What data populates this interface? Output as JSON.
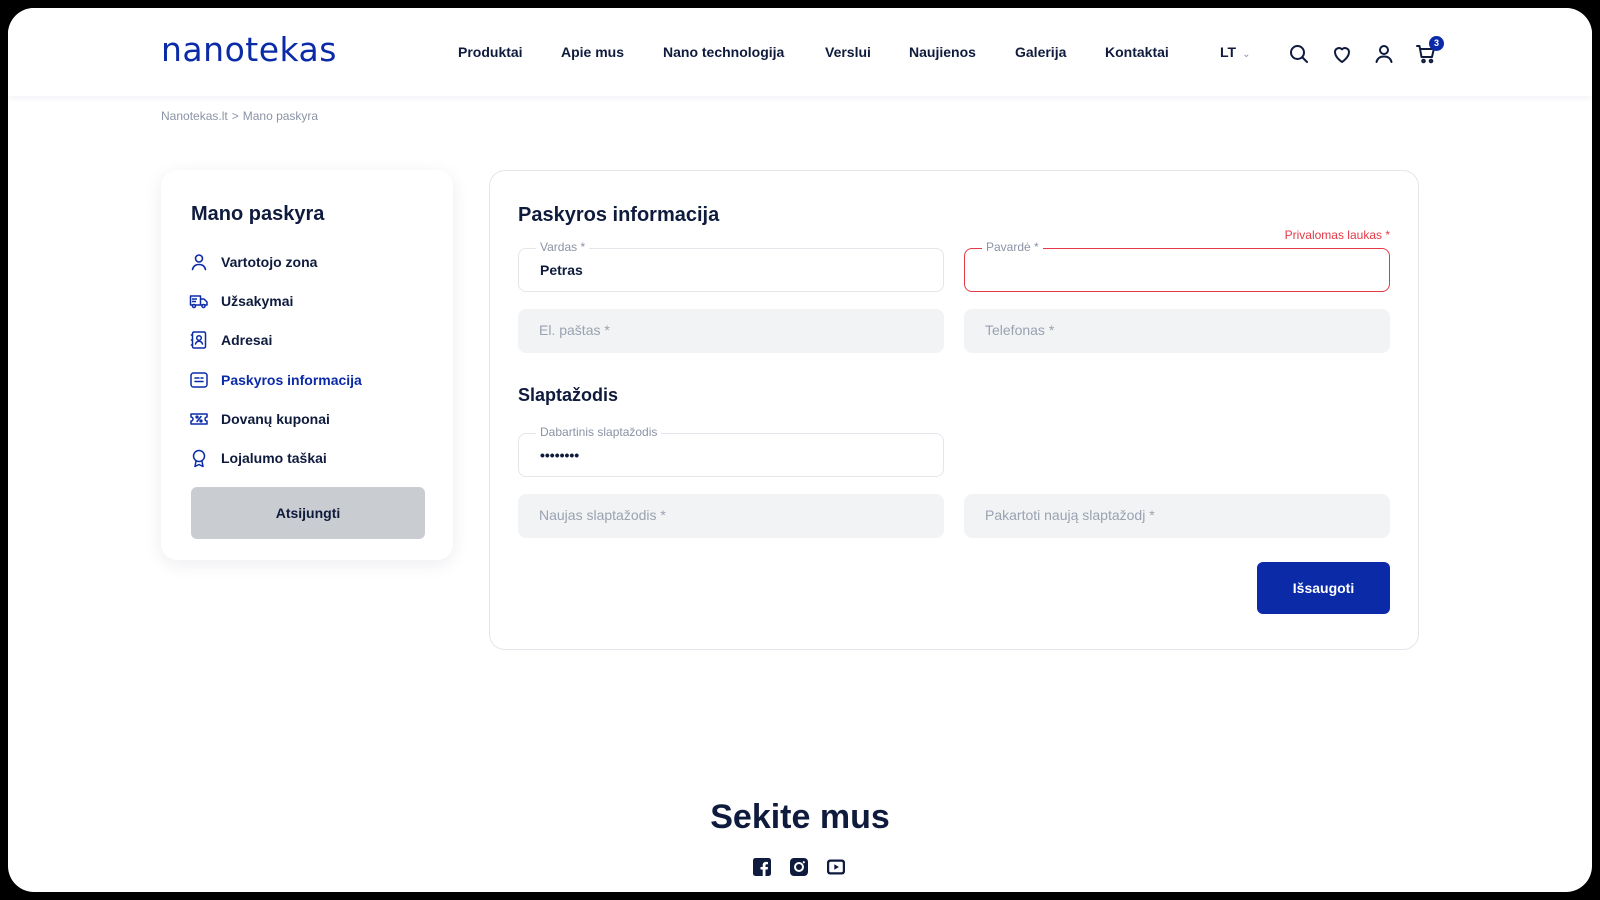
{
  "brand": {
    "logo_text_a": "nan",
    "logo_text_b": "o",
    "logo_text_c": "tekas"
  },
  "nav": {
    "items": [
      "Produktai",
      "Apie mus",
      "Nano technologija",
      "Verslui",
      "Naujienos",
      "Galerija",
      "Kontaktai"
    ],
    "language": "LT",
    "cart_count": "3"
  },
  "breadcrumb": {
    "home": "Nanotekas.lt",
    "separator": ">",
    "current": "Mano paskyra"
  },
  "sidebar": {
    "title": "Mano paskyra",
    "items": [
      {
        "label": "Vartotojo zona",
        "icon": "user-icon"
      },
      {
        "label": "Užsakymai",
        "icon": "truck-icon"
      },
      {
        "label": "Adresai",
        "icon": "contact-book-icon"
      },
      {
        "label": "Paskyros informacija",
        "icon": "id-card-icon",
        "active": true
      },
      {
        "label": "Dovanų kuponai",
        "icon": "coupon-icon"
      },
      {
        "label": "Lojalumo taškai",
        "icon": "award-icon"
      }
    ],
    "logout_label": "Atsijungti"
  },
  "account_info": {
    "title": "Paskyros informacija",
    "first_name": {
      "label": "Vardas *",
      "value": "Petras"
    },
    "last_name": {
      "label": "Pavardė *",
      "value": "",
      "error": "Privalomas laukas *"
    },
    "email": {
      "placeholder": "El. paštas *"
    },
    "phone": {
      "placeholder": "Telefonas *"
    }
  },
  "password": {
    "title": "Slaptažodis",
    "current": {
      "label": "Dabartinis slaptažodis",
      "value": "••••••••"
    },
    "new": {
      "placeholder": "Naujas slaptažodis *"
    },
    "repeat": {
      "placeholder": "Pakartoti naują slaptažodj *"
    }
  },
  "save_label": "Išsaugoti",
  "footer": {
    "follow_title": "Sekite mus",
    "socials": [
      "facebook-icon",
      "instagram-icon",
      "youtube-icon"
    ]
  },
  "colors": {
    "brand_blue": "#0a2aa8",
    "error_red": "#e53945",
    "text_dark": "#0f1b3d",
    "muted": "#8a93a6"
  }
}
